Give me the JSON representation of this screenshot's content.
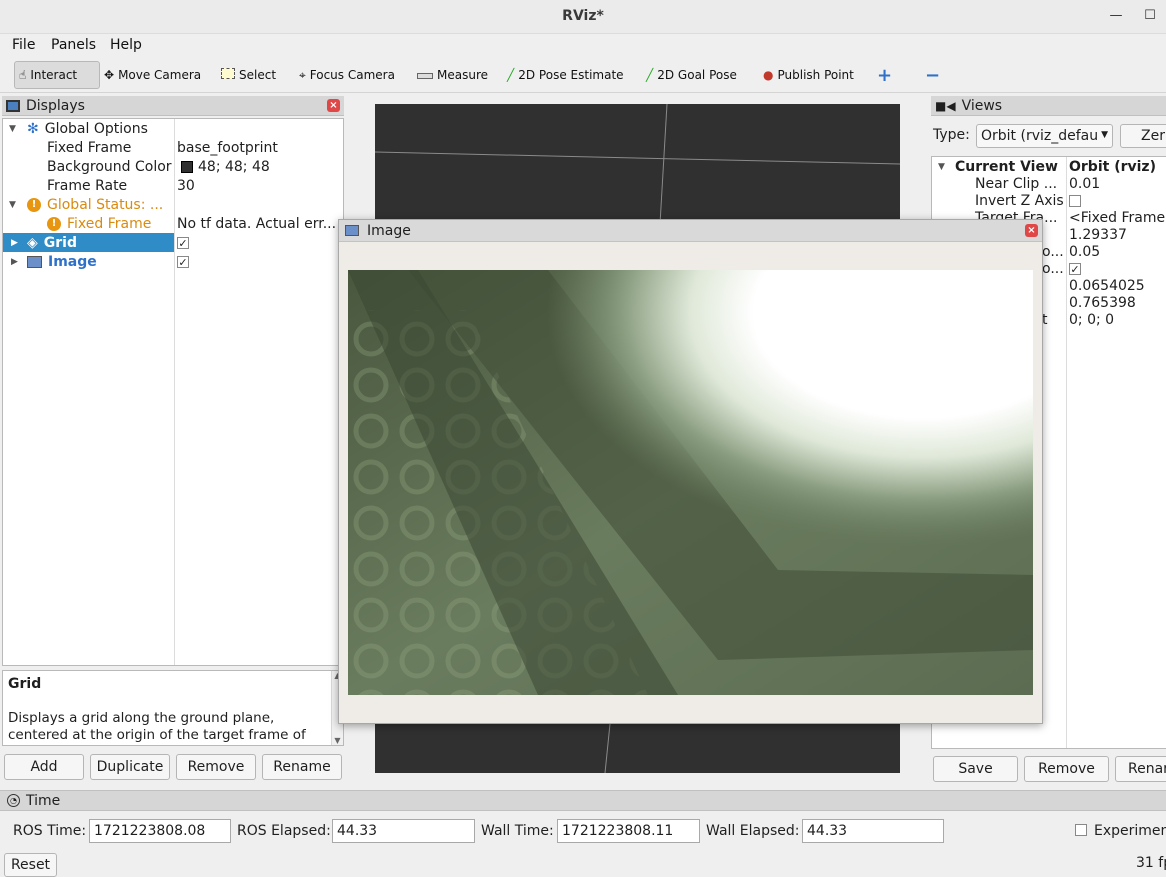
{
  "window": {
    "title": "RViz*"
  },
  "menu": {
    "file": "File",
    "panels": "Panels",
    "help": "Help"
  },
  "toolbar": {
    "interact": "Interact",
    "move_camera": "Move Camera",
    "select": "Select",
    "focus_camera": "Focus Camera",
    "measure": "Measure",
    "pose_estimate": "2D Pose Estimate",
    "goal_pose": "2D Goal Pose",
    "publish_point": "Publish Point",
    "add_symbol": "+",
    "remove_symbol": "−"
  },
  "displays": {
    "title": "Displays",
    "global_options": "Global Options",
    "fixed_frame_label": "Fixed Frame",
    "fixed_frame_value": "base_footprint",
    "background_color_label": "Background Color",
    "background_color_value": "48; 48; 48",
    "background_color_swatch": "#303030",
    "frame_rate_label": "Frame Rate",
    "frame_rate_value": "30",
    "global_status": "Global Status: ...",
    "status_fixed_frame": "Fixed Frame",
    "status_fixed_frame_value": "No tf data.  Actual err...",
    "grid": "Grid",
    "image": "Image",
    "desc_title": "Grid",
    "desc_text": "Displays a grid along the ground plane, centered at the origin of the target frame of",
    "buttons": {
      "add": "Add",
      "duplicate": "Duplicate",
      "remove": "Remove",
      "rename": "Rename"
    }
  },
  "image_panel": {
    "title": "Image"
  },
  "views": {
    "title": "Views",
    "type_label": "Type:",
    "type_value": "Orbit (rviz_defau",
    "zero_button": "Zer",
    "current_view": "Current View",
    "current_view_value": "Orbit (rviz)",
    "near_clip_label": "Near Clip ...",
    "near_clip_value": "0.01",
    "invert_z_label": "Invert Z Axis",
    "target_frame_label": "Target Fra...",
    "target_frame_value": "<Fixed Frame>",
    "distance_value": "1.29337",
    "focal_scale_label": "o...",
    "focal_scale_value": "0.05",
    "focal_shape_label": "o...",
    "yaw_value": "0.0654025",
    "pitch_value": "0.765398",
    "focal_point_label": "t",
    "focal_point_value": "0; 0; 0",
    "buttons": {
      "save": "Save",
      "remove": "Remove",
      "rename": "Renar"
    }
  },
  "time": {
    "title": "Time",
    "ros_time_label": "ROS Time:",
    "ros_time_value": "1721223808.08",
    "ros_elapsed_label": "ROS Elapsed:",
    "ros_elapsed_value": "44.33",
    "wall_time_label": "Wall Time:",
    "wall_time_value": "1721223808.11",
    "wall_elapsed_label": "Wall Elapsed:",
    "wall_elapsed_value": "44.33",
    "experimental_label": "Experimen",
    "reset_button": "Reset",
    "fps": "31 fp"
  },
  "colors": {
    "selection": "#308cc6",
    "warning": "#d98a10",
    "viewport": "#303030"
  }
}
